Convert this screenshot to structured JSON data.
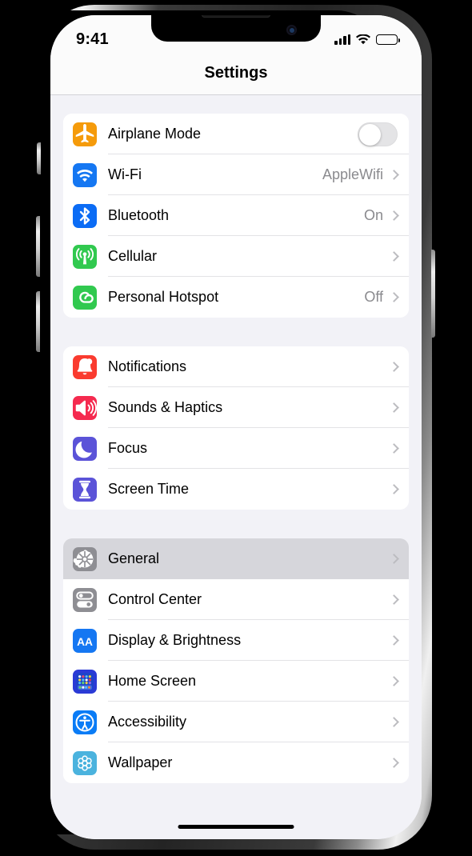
{
  "status_bar": {
    "time": "9:41",
    "cellular_icon": "cellular-bars-icon",
    "wifi_icon": "wifi-icon",
    "battery_icon": "battery-full-icon"
  },
  "nav": {
    "title": "Settings"
  },
  "groups": [
    {
      "id": "connectivity",
      "rows": [
        {
          "label": "Airplane Mode",
          "value": "",
          "icon": "airplane-icon",
          "icon_color": "#F59B0B",
          "control": "toggle",
          "toggle_on": false,
          "selected": false
        },
        {
          "label": "Wi-Fi",
          "value": "AppleWifi",
          "icon": "wifi-icon",
          "icon_color": "#1577F2",
          "control": "chevron",
          "selected": false
        },
        {
          "label": "Bluetooth",
          "value": "On",
          "icon": "bluetooth-icon",
          "icon_color": "#0B6CF5",
          "control": "chevron",
          "selected": false
        },
        {
          "label": "Cellular",
          "value": "",
          "icon": "cellular-antenna-icon",
          "icon_color": "#31C94F",
          "control": "chevron",
          "selected": false
        },
        {
          "label": "Personal Hotspot",
          "value": "Off",
          "icon": "hotspot-icon",
          "icon_color": "#31C94F",
          "control": "chevron",
          "selected": false
        }
      ]
    },
    {
      "id": "alerts",
      "rows": [
        {
          "label": "Notifications",
          "value": "",
          "icon": "bell-icon",
          "icon_color": "#FA3B2F",
          "control": "chevron",
          "selected": false
        },
        {
          "label": "Sounds & Haptics",
          "value": "",
          "icon": "speaker-icon",
          "icon_color": "#F52A4F",
          "control": "chevron",
          "selected": false
        },
        {
          "label": "Focus",
          "value": "",
          "icon": "moon-icon",
          "icon_color": "#5B53D8",
          "control": "chevron",
          "selected": false
        },
        {
          "label": "Screen Time",
          "value": "",
          "icon": "hourglass-icon",
          "icon_color": "#5B53D8",
          "control": "chevron",
          "selected": false
        }
      ]
    },
    {
      "id": "system",
      "rows": [
        {
          "label": "General",
          "value": "",
          "icon": "gear-icon",
          "icon_color": "#8E8E93",
          "control": "chevron",
          "selected": true
        },
        {
          "label": "Control Center",
          "value": "",
          "icon": "control-center-icon",
          "icon_color": "#8E8E93",
          "control": "chevron",
          "selected": false
        },
        {
          "label": "Display & Brightness",
          "value": "",
          "icon": "display-brightness-icon",
          "icon_color": "#1577F2",
          "control": "chevron",
          "selected": false
        },
        {
          "label": "Home Screen",
          "value": "",
          "icon": "home-screen-icon",
          "icon_color": "#2B3AD6",
          "control": "chevron",
          "selected": false
        },
        {
          "label": "Accessibility",
          "value": "",
          "icon": "accessibility-icon",
          "icon_color": "#0A7CF6",
          "control": "chevron",
          "selected": false
        },
        {
          "label": "Wallpaper",
          "value": "",
          "icon": "wallpaper-icon",
          "icon_color": "#4BB3DE",
          "control": "chevron",
          "selected": false
        }
      ]
    }
  ],
  "colors": {
    "page_background": "#F2F2F7",
    "card_background": "#FFFFFF",
    "selected_row": "#D6D6DB",
    "secondary_text": "#8A8A8E",
    "chevron": "#BCBCC0"
  }
}
